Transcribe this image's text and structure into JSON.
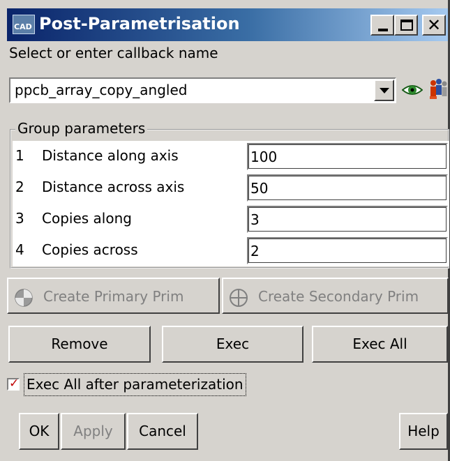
{
  "window": {
    "title": "Post-Parametrisation",
    "app_icon_text": "CAD"
  },
  "callback": {
    "prompt": "Select or enter callback name",
    "value": "ppcb_array_copy_angled"
  },
  "group": {
    "legend": "Group parameters",
    "rows": [
      {
        "num": "1",
        "label": "Distance along axis",
        "value": "100"
      },
      {
        "num": "2",
        "label": "Distance across axis",
        "value": "50"
      },
      {
        "num": "3",
        "label": "Copies along",
        "value": "3"
      },
      {
        "num": "4",
        "label": "Copies across",
        "value": "2"
      }
    ]
  },
  "create_buttons": {
    "primary": "Create Primary Prim",
    "secondary": "Create Secondary Prim"
  },
  "actions": {
    "remove": "Remove",
    "exec": "Exec",
    "exec_all": "Exec All"
  },
  "exec_after": {
    "label": "Exec All after parameterization",
    "checked": true
  },
  "footer": {
    "ok": "OK",
    "apply": "Apply",
    "cancel": "Cancel",
    "help": "Help"
  },
  "colors": {
    "title_start": "#0a246a",
    "title_end": "#a6caf0",
    "face": "#d6d3ce",
    "check": "#c00000"
  },
  "icons": [
    "app-icon",
    "minimize-icon",
    "maximize-icon",
    "close-icon",
    "dropdown-arrow-icon",
    "eye-icon",
    "people-icon",
    "primary-prim-icon",
    "secondary-prim-icon",
    "checkmark-icon"
  ]
}
